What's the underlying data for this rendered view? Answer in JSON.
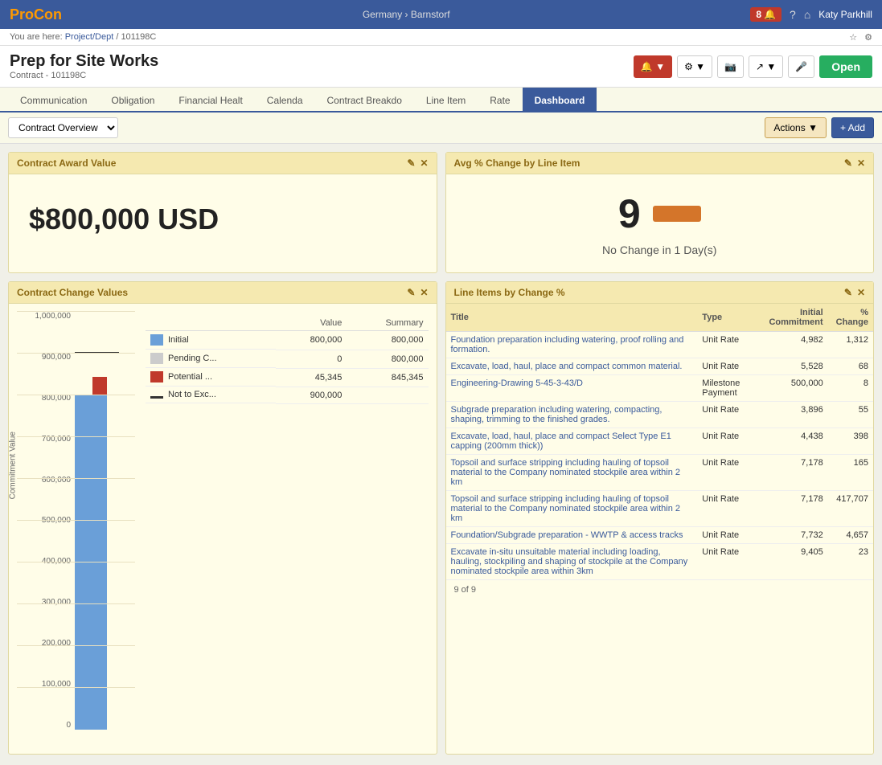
{
  "app": {
    "logo_text": "Pro",
    "logo_accent": "Con",
    "location": "Germany › Barnstorf"
  },
  "topnav": {
    "notification_count": "8",
    "user_name": "Katy Parkhill"
  },
  "breadcrumb": {
    "prefix": "You are here:",
    "link1": "Project/Dept",
    "separator": "/",
    "current": "101198C"
  },
  "page": {
    "title": "Prep for Site Works",
    "subtitle": "Contract - 101198C"
  },
  "header_buttons": {
    "open_label": "Open"
  },
  "tabs": [
    {
      "label": "Communication",
      "active": false
    },
    {
      "label": "Obligation",
      "active": false
    },
    {
      "label": "Financial Healt",
      "active": false
    },
    {
      "label": "Calenda",
      "active": false
    },
    {
      "label": "Contract Breakdo",
      "active": false
    },
    {
      "label": "Line Item",
      "active": false
    },
    {
      "label": "Rate",
      "active": false
    },
    {
      "label": "Dashboard",
      "active": true
    }
  ],
  "toolbar": {
    "dropdown_value": "Contract Overview",
    "actions_label": "Actions",
    "add_label": "+ Add"
  },
  "widget_award": {
    "title": "Contract Award Value",
    "value": "$800,000 USD"
  },
  "widget_avg_change": {
    "title": "Avg % Change by Line Item",
    "number": "9",
    "label": "No Change in 1 Day(s)"
  },
  "widget_change_values": {
    "title": "Contract Change Values",
    "y_axis_label": "Commitment Value",
    "y_labels": [
      "1,000,000",
      "900,000",
      "800,000",
      "700,000",
      "600,000",
      "500,000",
      "400,000",
      "300,000",
      "200,000",
      "100,000",
      "0"
    ],
    "col_value": "Value",
    "col_summary": "Summary",
    "legend": [
      {
        "color": "#6a9fd8",
        "label": "Initial",
        "value": "800,000",
        "summary": "800,000"
      },
      {
        "color": "#cccccc",
        "label": "Pending C...",
        "value": "0",
        "summary": "800,000"
      },
      {
        "color": "#c0392b",
        "label": "Potential ...",
        "value": "45,345",
        "summary": "845,345"
      },
      {
        "color": "#333333",
        "label": "Not to Exc...",
        "value": "900,000",
        "summary": "",
        "is_line": true
      }
    ]
  },
  "widget_line_items": {
    "title": "Line Items by Change %",
    "columns": [
      "Title",
      "Type",
      "Initial Commitment",
      "% Change"
    ],
    "rows": [
      {
        "title": "Foundation preparation including watering, proof rolling and formation.",
        "type": "Unit Rate",
        "commitment": "4,982",
        "change": "1,312"
      },
      {
        "title": "Excavate, load, haul, place and compact common material.",
        "type": "Unit Rate",
        "commitment": "5,528",
        "change": "68"
      },
      {
        "title": "Engineering-Drawing 5-45-3-43/D",
        "type": "Milestone Payment",
        "commitment": "500,000",
        "change": "8"
      },
      {
        "title": "Subgrade preparation including watering, compacting, shaping, trimming to the finished grades.",
        "type": "Unit Rate",
        "commitment": "3,896",
        "change": "55"
      },
      {
        "title": "Excavate, load, haul, place and compact Select Type E1 capping (200mm thick))",
        "type": "Unit Rate",
        "commitment": "4,438",
        "change": "398"
      },
      {
        "title": "Topsoil and surface stripping including hauling of topsoil material to the Company nominated stockpile area within 2 km",
        "type": "Unit Rate",
        "commitment": "7,178",
        "change": "165"
      },
      {
        "title": "Topsoil and surface stripping including hauling of topsoil material to the Company nominated stockpile area within 2 km",
        "type": "Unit Rate",
        "commitment": "7,178",
        "change": "417,707"
      },
      {
        "title": "Foundation/Subgrade preparation - WWTP & access tracks",
        "type": "Unit Rate",
        "commitment": "7,732",
        "change": "4,657"
      },
      {
        "title": "Excavate in-situ unsuitable material including loading, hauling, stockpiling and shaping of stockpile at the Company nominated stockpile area within 3km",
        "type": "Unit Rate",
        "commitment": "9,405",
        "change": "23"
      }
    ],
    "pagination": "9 of 9"
  }
}
